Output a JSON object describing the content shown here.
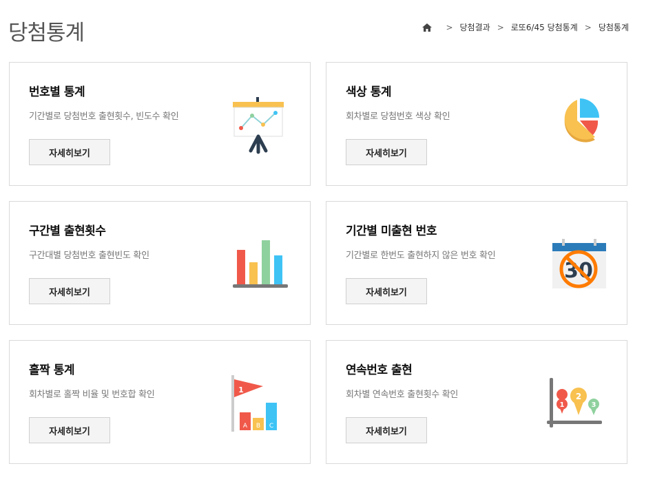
{
  "page": {
    "title": "당첨통계"
  },
  "breadcrumb": {
    "items": [
      "당첨결과",
      "로또6/45 당첨통계",
      "당첨통계"
    ]
  },
  "cards": [
    {
      "title": "번호별 통계",
      "desc": "기간별로 당첨번호 출현횟수, 빈도수 확인",
      "button": "자세히보기",
      "icon": "presentation-chart-icon"
    },
    {
      "title": "색상 통계",
      "desc": "회차별로 당첨번호 색상 확인",
      "button": "자세히보기",
      "icon": "pie-chart-icon"
    },
    {
      "title": "구간별 출현횟수",
      "desc": "구간대별 당첨번호 출현빈도 확인",
      "button": "자세히보기",
      "icon": "bar-chart-icon"
    },
    {
      "title": "기간별 미출현 번호",
      "desc": "기간별로 한번도 출현하지 않은 번호 확인",
      "button": "자세히보기",
      "icon": "calendar-prohibited-icon"
    },
    {
      "title": "홀짝 통계",
      "desc": "회차별로 홀짝 비율 및 번호합 확인",
      "button": "자세히보기",
      "icon": "flag-bars-icon"
    },
    {
      "title": "연속번호 출현",
      "desc": "회차별 연속번호 출현횟수 확인",
      "button": "자세히보기",
      "icon": "map-pin-chart-icon"
    }
  ],
  "icon_text": {
    "calendar_number": "30",
    "flag_number": "1",
    "bar_letters": [
      "A",
      "B",
      "C"
    ],
    "pin_numbers": [
      "1",
      "2",
      "3"
    ]
  },
  "colors": {
    "red": "#f0594a",
    "yellow": "#f8c150",
    "green": "#8fd19e",
    "blue": "#3fc3f5",
    "orange": "#ff7b00",
    "navy": "#2d3e50"
  }
}
